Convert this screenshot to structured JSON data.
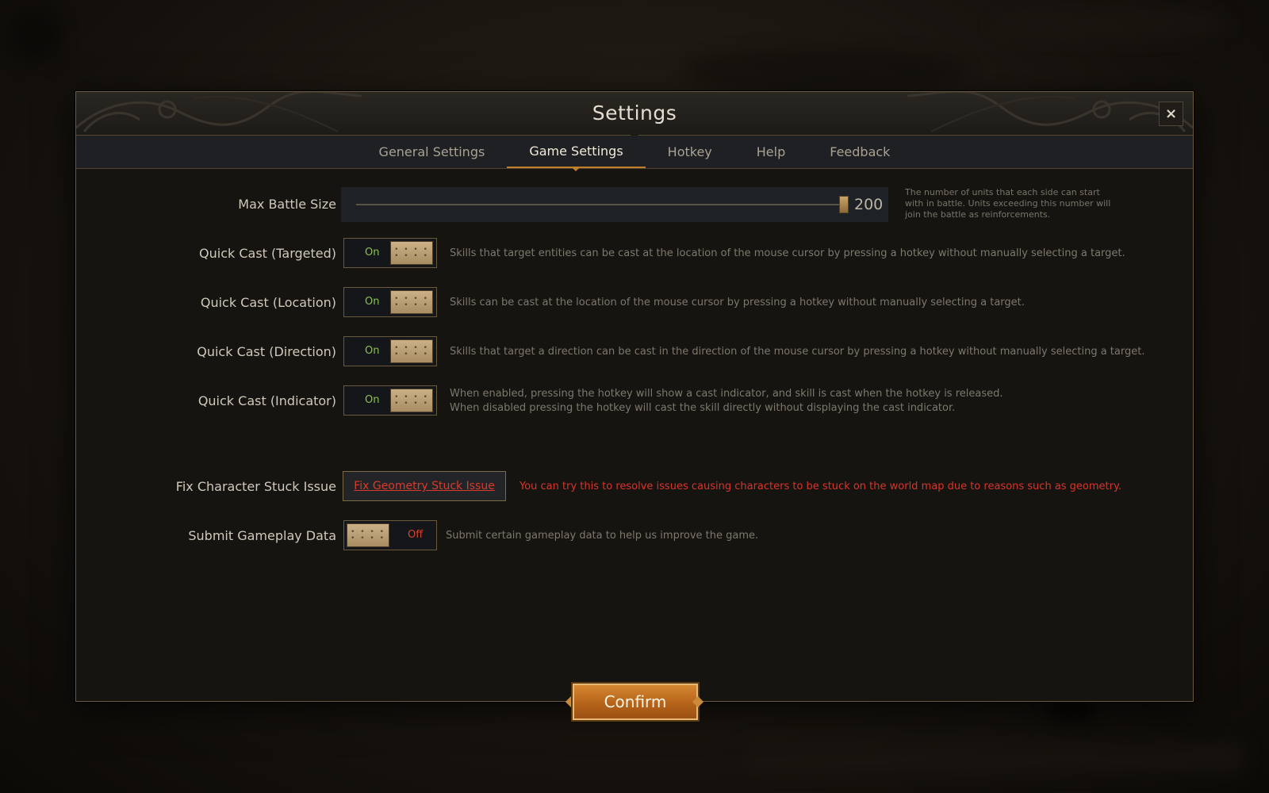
{
  "dialog": {
    "title": "Settings",
    "close_icon": "close-icon",
    "close_glyph": "×"
  },
  "tabs": [
    {
      "label": "General Settings",
      "active": false
    },
    {
      "label": "Game Settings",
      "active": true
    },
    {
      "label": "Hotkey",
      "active": false
    },
    {
      "label": "Help",
      "active": false
    },
    {
      "label": "Feedback",
      "active": false
    }
  ],
  "settings": {
    "max_battle_size": {
      "label": "Max Battle Size",
      "value": "200",
      "level": 1.0,
      "description": "The number of units that each side can start with in battle. Units exceeding this number will join the battle as reinforcements."
    },
    "quick_cast_targeted": {
      "label": "Quick Cast (Targeted)",
      "state": "On",
      "description": "Skills that target entities can be cast at the location of the mouse cursor by pressing a hotkey without manually selecting a target."
    },
    "quick_cast_location": {
      "label": "Quick Cast (Location)",
      "state": "On",
      "description": "Skills can be cast at the location of the mouse cursor by pressing a hotkey without manually selecting a target."
    },
    "quick_cast_direction": {
      "label": "Quick Cast (Direction)",
      "state": "On",
      "description": "Skills that target a direction can be cast in the direction of the mouse cursor by pressing a hotkey without manually selecting a target."
    },
    "quick_cast_indicator": {
      "label": "Quick Cast (Indicator)",
      "state": "On",
      "description_line1": "When enabled, pressing the hotkey will show a cast indicator, and skill is cast when the hotkey is released.",
      "description_line2": "When disabled pressing the hotkey will cast the skill directly without displaying the cast indicator."
    },
    "fix_character_stuck": {
      "label": "Fix Character Stuck Issue",
      "button_label": "Fix Geometry Stuck Issue",
      "warning": "You can try this to resolve issues causing characters to be stuck on the world map due to reasons such as geometry."
    },
    "submit_gameplay_data": {
      "label": "Submit Gameplay Data",
      "state": "Off",
      "description": "Submit certain gameplay data to help us improve the game."
    }
  },
  "footer": {
    "confirm_label": "Confirm"
  },
  "colors": {
    "accent": "#c07d2a",
    "toggle_on": "#8fbf5a",
    "toggle_off": "#d8432f",
    "warning": "#d8342a"
  }
}
